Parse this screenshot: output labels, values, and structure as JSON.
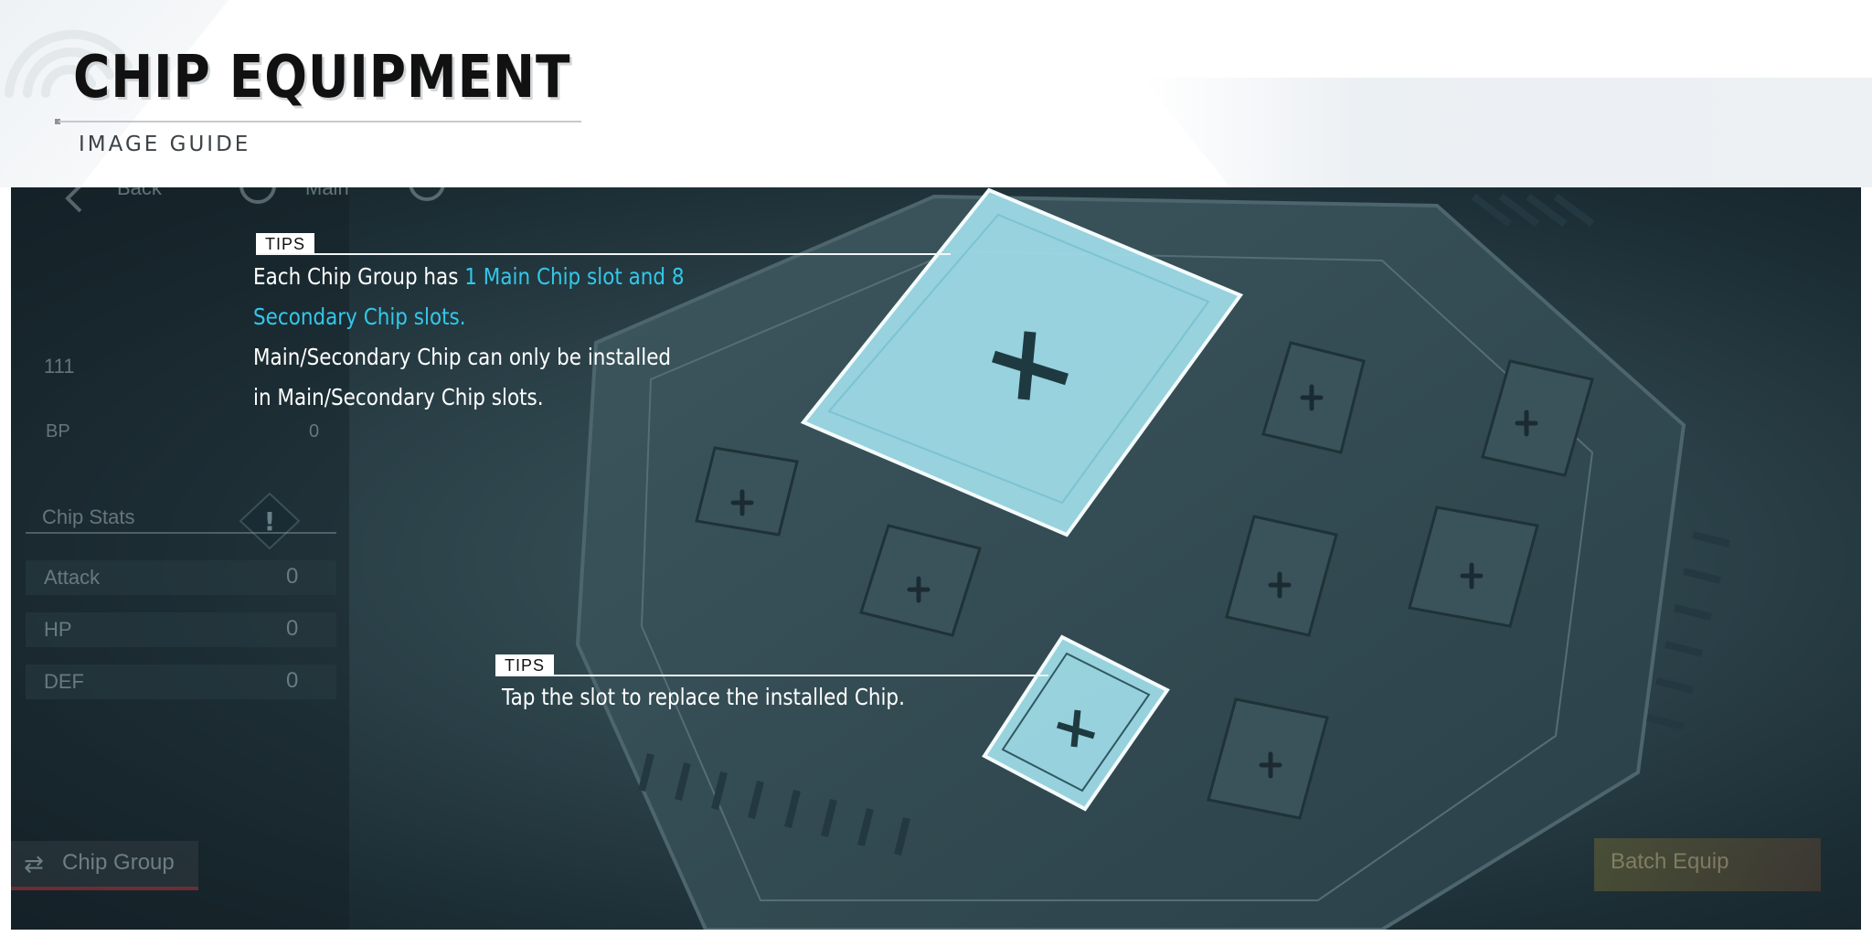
{
  "header": {
    "title": "CHIP EQUIPMENT",
    "subtitle": "IMAGE GUIDE"
  },
  "game_ui": {
    "back_label": "Back",
    "main_label": "Main",
    "chip_id": "111",
    "bp_label": "BP",
    "bp_value": "0",
    "chip_stats_label": "Chip Stats",
    "stats": [
      {
        "label": "Attack",
        "value": "0"
      },
      {
        "label": "HP",
        "value": "0"
      },
      {
        "label": "DEF",
        "value": "0"
      }
    ],
    "chip_group_button": "Chip Group",
    "batch_equip_button": "Batch Equip"
  },
  "tips": [
    {
      "tag": "TIPS",
      "line1_a": "Each Chip Group has ",
      "line1_b": "1 Main Chip slot and 8",
      "line2": "Secondary Chip slots.",
      "line3": "Main/Secondary Chip can only be installed",
      "line4": "in Main/Secondary Chip slots."
    },
    {
      "tag": "TIPS",
      "text": "Tap the slot to replace the installed Chip."
    }
  ],
  "colors": {
    "highlight": "#32c8ea",
    "slot_fill": "#9fdde9",
    "scene_dark": "#1b2c33"
  },
  "icons": [
    "wifi-icon",
    "back-arrow-icon",
    "main-icon",
    "alert-icon",
    "swap-icon",
    "plus-icon"
  ]
}
